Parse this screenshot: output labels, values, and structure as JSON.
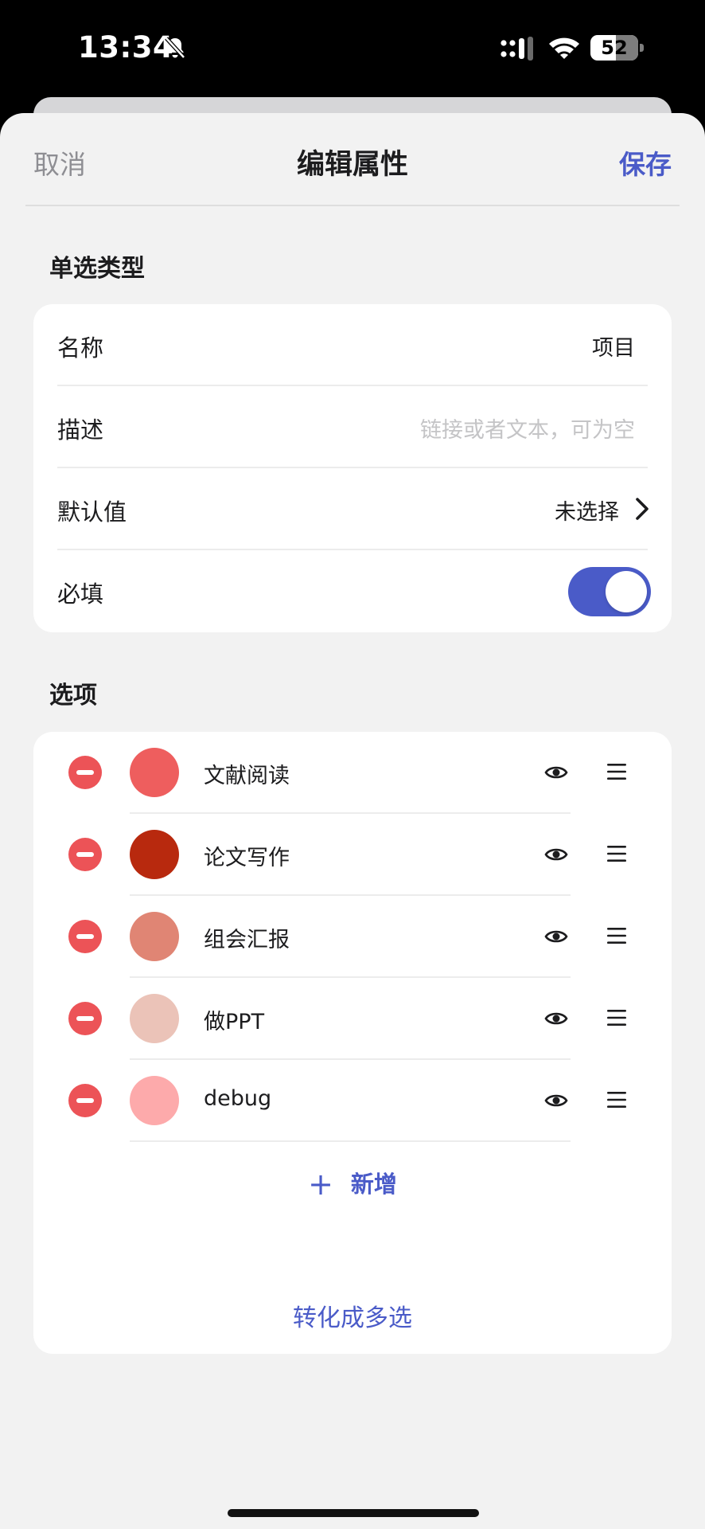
{
  "status_bar": {
    "time": "13:34",
    "battery": "52"
  },
  "nav": {
    "cancel": "取消",
    "title": "编辑属性",
    "save": "保存"
  },
  "section_type": {
    "label": "单选类型"
  },
  "fields": {
    "name": {
      "label": "名称",
      "value": "项目"
    },
    "description": {
      "label": "描述",
      "placeholder": "链接或者文本，可为空"
    },
    "default": {
      "label": "默认值",
      "value": "未选择"
    },
    "required": {
      "label": "必填",
      "on": true
    }
  },
  "section_options": {
    "label": "选项"
  },
  "options": [
    {
      "label": "文献阅读",
      "color": "#ee5e5e"
    },
    {
      "label": "论文写作",
      "color": "#b8290e"
    },
    {
      "label": "组会汇报",
      "color": "#e08574"
    },
    {
      "label": "做PPT",
      "color": "#ebc3b8"
    },
    {
      "label": "debug",
      "color": "#fdaaab"
    }
  ],
  "add_option": {
    "label": "新增"
  },
  "convert": {
    "label": "转化成多选"
  },
  "colors": {
    "accent": "#4a5bc8",
    "danger": "#ec5357"
  }
}
